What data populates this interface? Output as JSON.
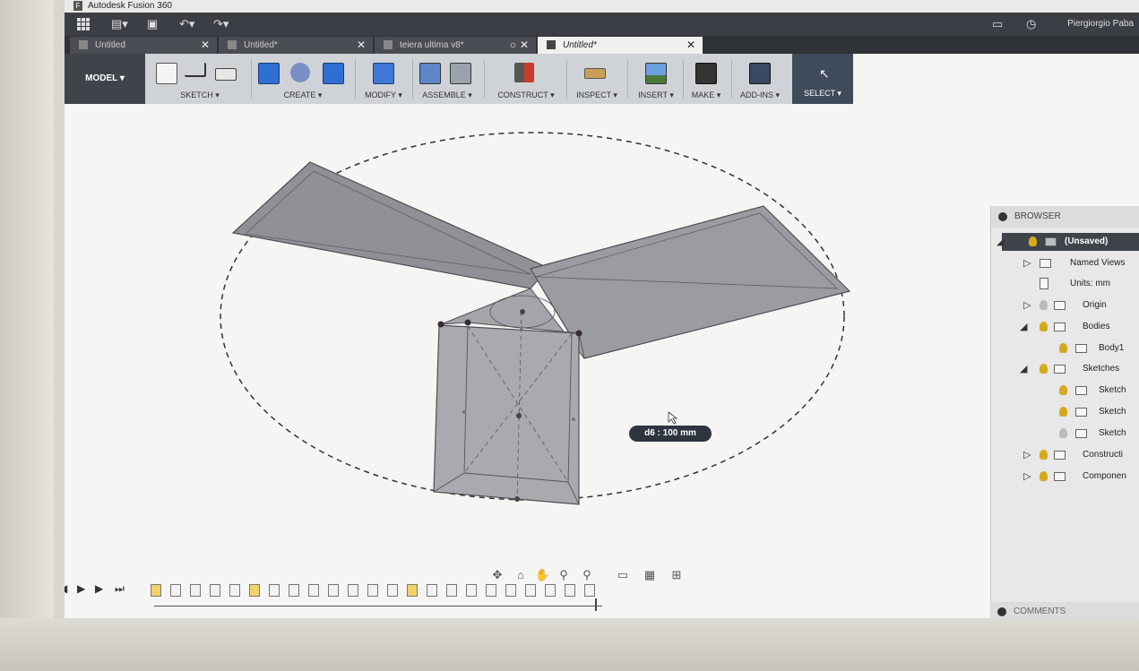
{
  "window": {
    "app_title": "Autodesk Fusion 360",
    "user": "Piergiorgio Paba"
  },
  "tabs": [
    {
      "label": "Untitled",
      "active": false
    },
    {
      "label": "Untitled*",
      "active": false
    },
    {
      "label": "teiera ultima v8*",
      "active": false
    },
    {
      "label": "Untitled*",
      "active": true
    }
  ],
  "toolbar": {
    "model": "MODEL ▾",
    "groups": [
      {
        "label": "SKETCH ▾"
      },
      {
        "label": "CREATE ▾"
      },
      {
        "label": "MODIFY ▾"
      },
      {
        "label": "ASSEMBLE ▾"
      },
      {
        "label": "CONSTRUCT ▾"
      },
      {
        "label": "INSPECT ▾"
      },
      {
        "label": "INSERT ▾"
      },
      {
        "label": "MAKE ▾"
      },
      {
        "label": "ADD-INS ▾"
      },
      {
        "label": "SELECT ▾"
      }
    ]
  },
  "viewport": {
    "dimension_label": "d6 : 100 mm"
  },
  "browser": {
    "title": "BROWSER",
    "items": [
      {
        "label": "(Unsaved)"
      },
      {
        "label": "Named Views"
      },
      {
        "label": "Units: mm"
      },
      {
        "label": "Origin"
      },
      {
        "label": "Bodies"
      },
      {
        "label": "Body1"
      },
      {
        "label": "Sketches"
      },
      {
        "label": "Sketch"
      },
      {
        "label": "Sketch"
      },
      {
        "label": "Sketch"
      },
      {
        "label": "Constructi"
      },
      {
        "label": "Componen"
      }
    ]
  },
  "comments": {
    "label": "COMMENTS"
  },
  "colors": {
    "accent": "#3f444b",
    "body": "#8f9197",
    "bulb": "#d6a91c"
  }
}
